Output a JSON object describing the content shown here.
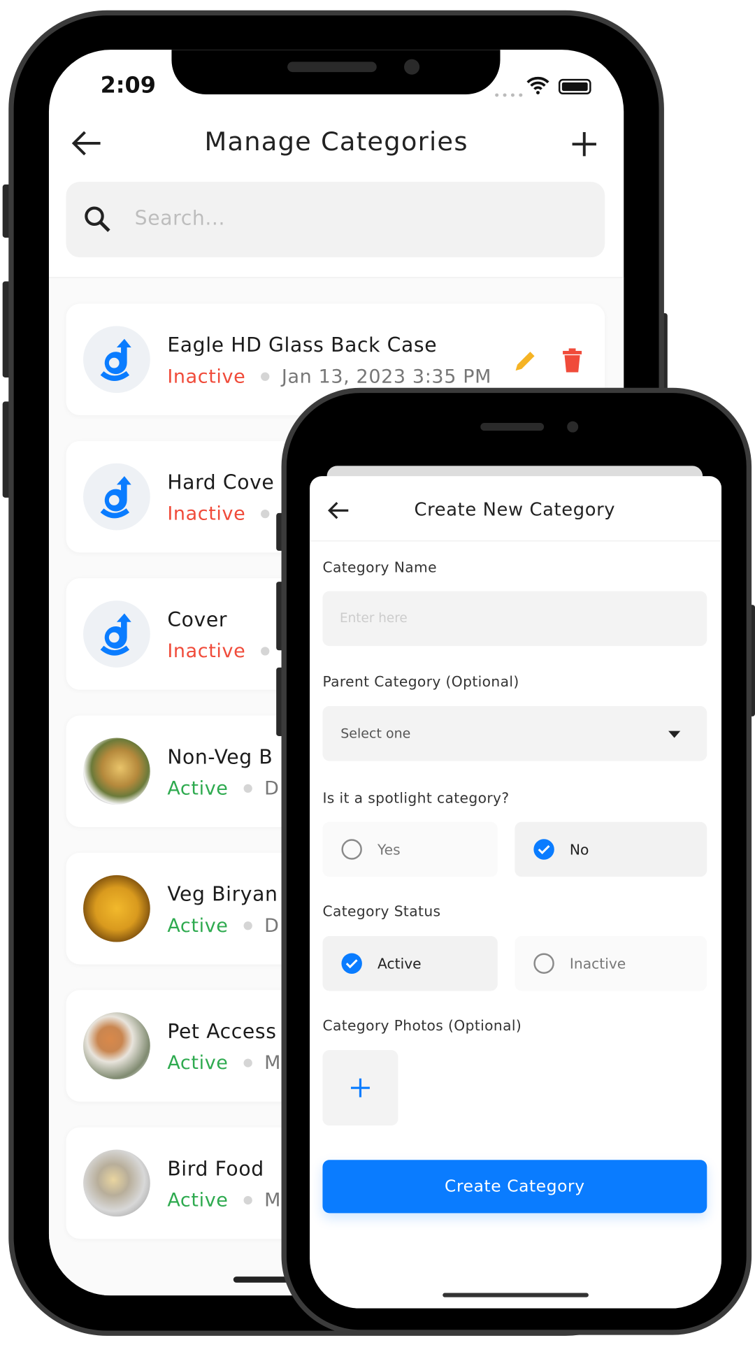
{
  "back_phone": {
    "status_bar": {
      "time": "2:09"
    },
    "header": {
      "title": "Manage Categories",
      "back_icon": "arrow-left-icon",
      "add_icon": "plus-icon"
    },
    "search": {
      "placeholder": "Search..."
    },
    "categories": [
      {
        "name": "Eagle HD Glass Back Case",
        "status": "Inactive",
        "date": "Jan 13, 2023 3:35 PM",
        "image": "logo"
      },
      {
        "name": "Hard Cove",
        "status": "Inactive",
        "date": "",
        "image": "logo"
      },
      {
        "name": "Cover",
        "status": "Inactive",
        "date": "",
        "image": "logo"
      },
      {
        "name": "Non-Veg B",
        "status": "Active",
        "date": "D",
        "image": "non-veg-biryani-photo"
      },
      {
        "name": "Veg Biryan",
        "status": "Active",
        "date": "D",
        "image": "veg-biryani-photo"
      },
      {
        "name": "Pet Access",
        "status": "Active",
        "date": "M",
        "image": "pet-photo"
      },
      {
        "name": "Bird Food",
        "status": "Active",
        "date": "M",
        "image": "bird-photo"
      }
    ],
    "colors": {
      "inactive": "#f04b3a",
      "active": "#2eaa4f",
      "edit": "#f5b324",
      "delete": "#f04b3a",
      "logo": "#0a7cff"
    }
  },
  "front_phone": {
    "header": {
      "title": "Create New Category"
    },
    "form": {
      "name_label": "Category Name",
      "name_placeholder": "Enter here",
      "parent_label": "Parent Category (Optional)",
      "parent_value": "Select one",
      "spotlight_label": "Is it a spotlight category?",
      "spotlight_options": [
        "Yes",
        "No"
      ],
      "spotlight_selected": "No",
      "status_label": "Category Status",
      "status_options": [
        "Active",
        "Inactive"
      ],
      "status_selected": "Active",
      "photos_label": "Category Photos (Optional)",
      "submit_label": "Create Category"
    },
    "colors": {
      "primary": "#0a7cff"
    }
  }
}
